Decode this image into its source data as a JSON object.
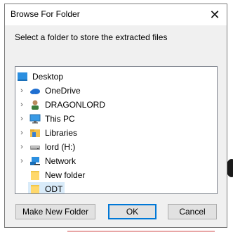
{
  "dialog": {
    "title": "Browse For Folder",
    "instruction": "Select a folder to store the extracted files"
  },
  "tree": {
    "items": [
      {
        "label": "Desktop",
        "icon": "desktop-icon",
        "expandable": false
      },
      {
        "label": "OneDrive",
        "icon": "cloud-icon",
        "expandable": true
      },
      {
        "label": "DRAGONLORD",
        "icon": "user-icon",
        "expandable": true
      },
      {
        "label": "This PC",
        "icon": "computer-icon",
        "expandable": true
      },
      {
        "label": "Libraries",
        "icon": "libraries-icon",
        "expandable": true
      },
      {
        "label": "lord (H:)",
        "icon": "drive-icon",
        "expandable": true
      },
      {
        "label": "Network",
        "icon": "network-icon",
        "expandable": true
      },
      {
        "label": "New folder",
        "icon": "folder-icon",
        "expandable": false
      },
      {
        "label": "ODT",
        "icon": "folder-icon",
        "expandable": false,
        "selected": true
      }
    ]
  },
  "buttons": {
    "make_new_folder": "Make New Folder",
    "ok": "OK",
    "cancel": "Cancel"
  },
  "colors": {
    "selection": "#d9ebf9",
    "default_button_border": "#0078d7",
    "folder": "#ffd86b"
  }
}
